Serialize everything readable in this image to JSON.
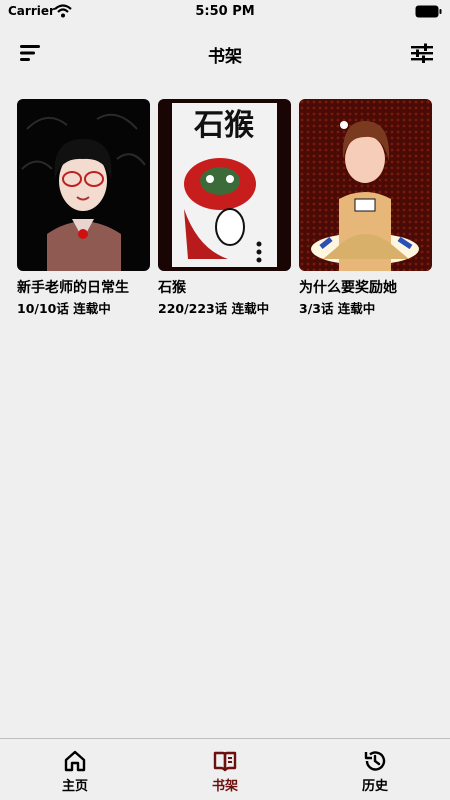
{
  "status_bar": {
    "carrier": "Carrier",
    "time": "5:50 PM"
  },
  "header": {
    "title": "书架"
  },
  "books": [
    {
      "title": "新手老师的日常生",
      "progress": "10/10话 连载中"
    },
    {
      "title": "石猴",
      "progress": "220/223话 连载中",
      "cover_text": "石猴"
    },
    {
      "title": "为什么要奖励她",
      "progress": "3/3话 连载中"
    }
  ],
  "tabs": [
    {
      "label": "主页",
      "icon": "home-icon"
    },
    {
      "label": "书架",
      "icon": "bookshelf-icon",
      "active": true
    },
    {
      "label": "历史",
      "icon": "history-icon"
    }
  ],
  "colors": {
    "background": "#efefef",
    "active_tab": "#6b0f0f",
    "text": "#000000"
  }
}
